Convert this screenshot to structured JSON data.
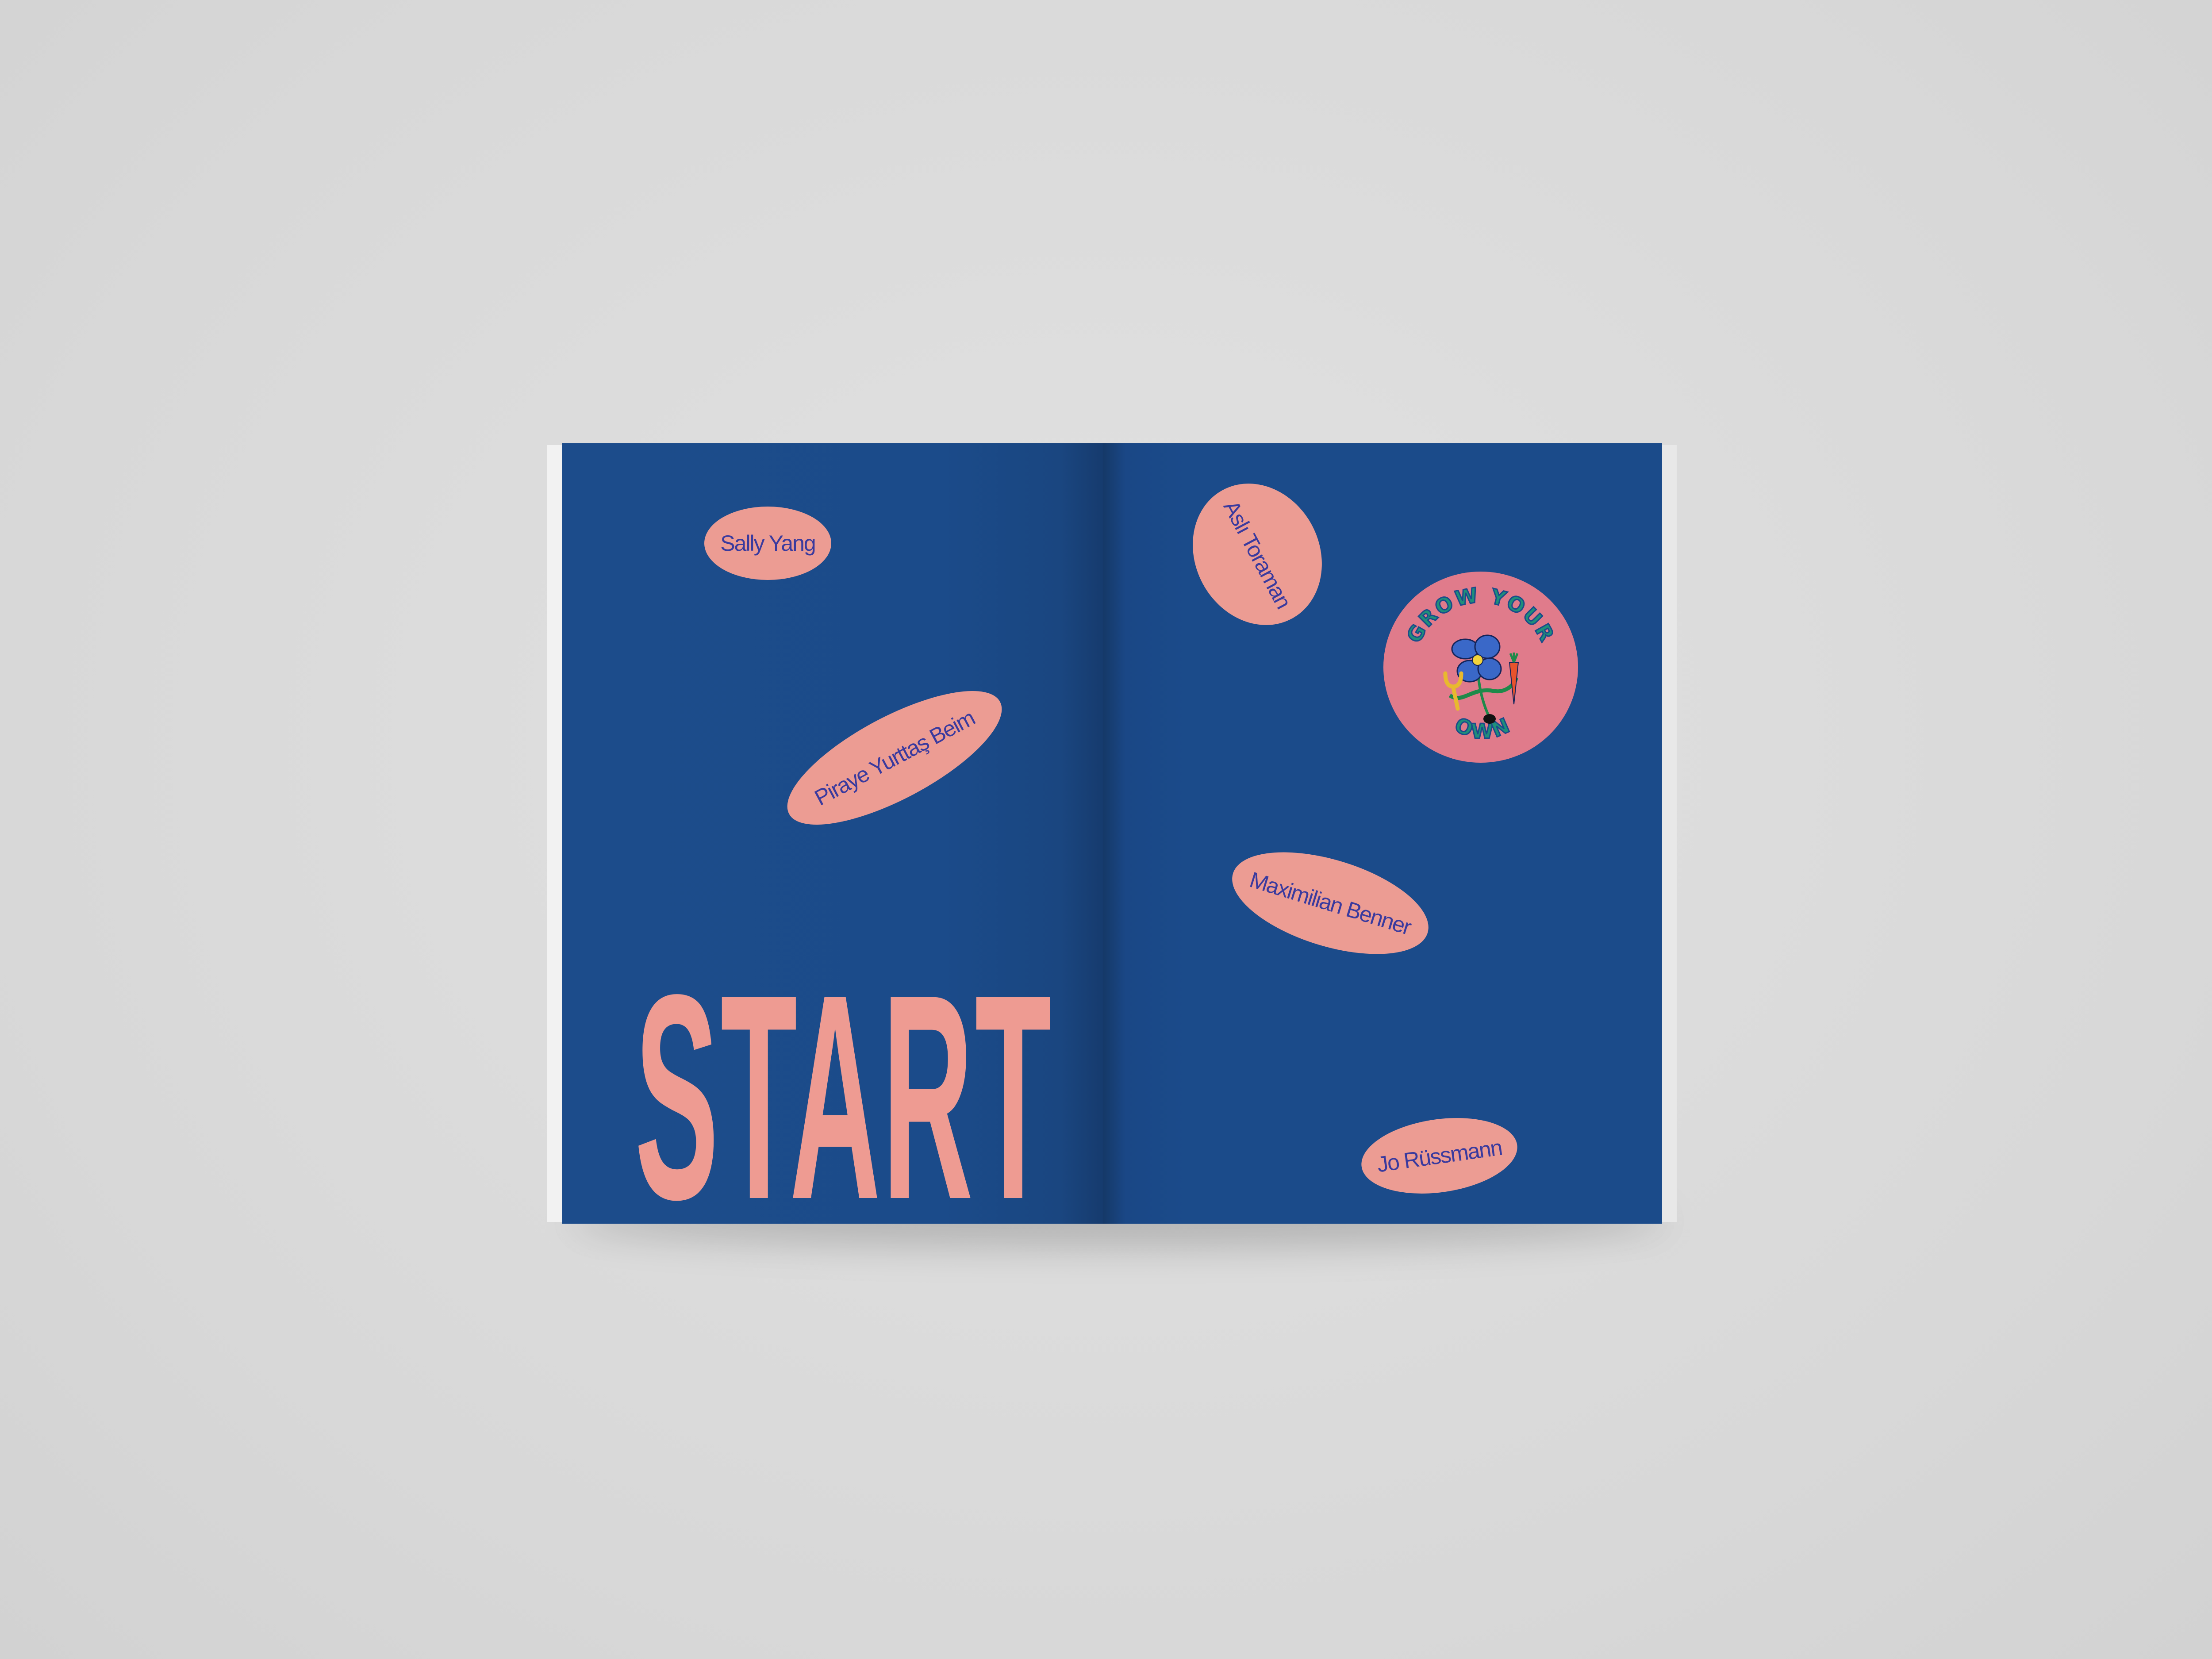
{
  "left_page": {
    "names": [
      "Sally Yang",
      "Piraye Yurttaş Beim"
    ],
    "headline": "START"
  },
  "right_page": {
    "names": [
      "Aslı Toraman",
      "Maximilian Benner",
      "Jo Rüssmann"
    ],
    "sticker": {
      "line1": "GROW YOUR",
      "line2": "OWN"
    }
  },
  "colors": {
    "background": "#dbdbdb",
    "page_blue": "#1b4b8a",
    "pink": "#ec9c93",
    "name_text": "#3a3a9e",
    "sticker_pink": "#e07b8b",
    "sticker_text": "#1f8f7a"
  }
}
